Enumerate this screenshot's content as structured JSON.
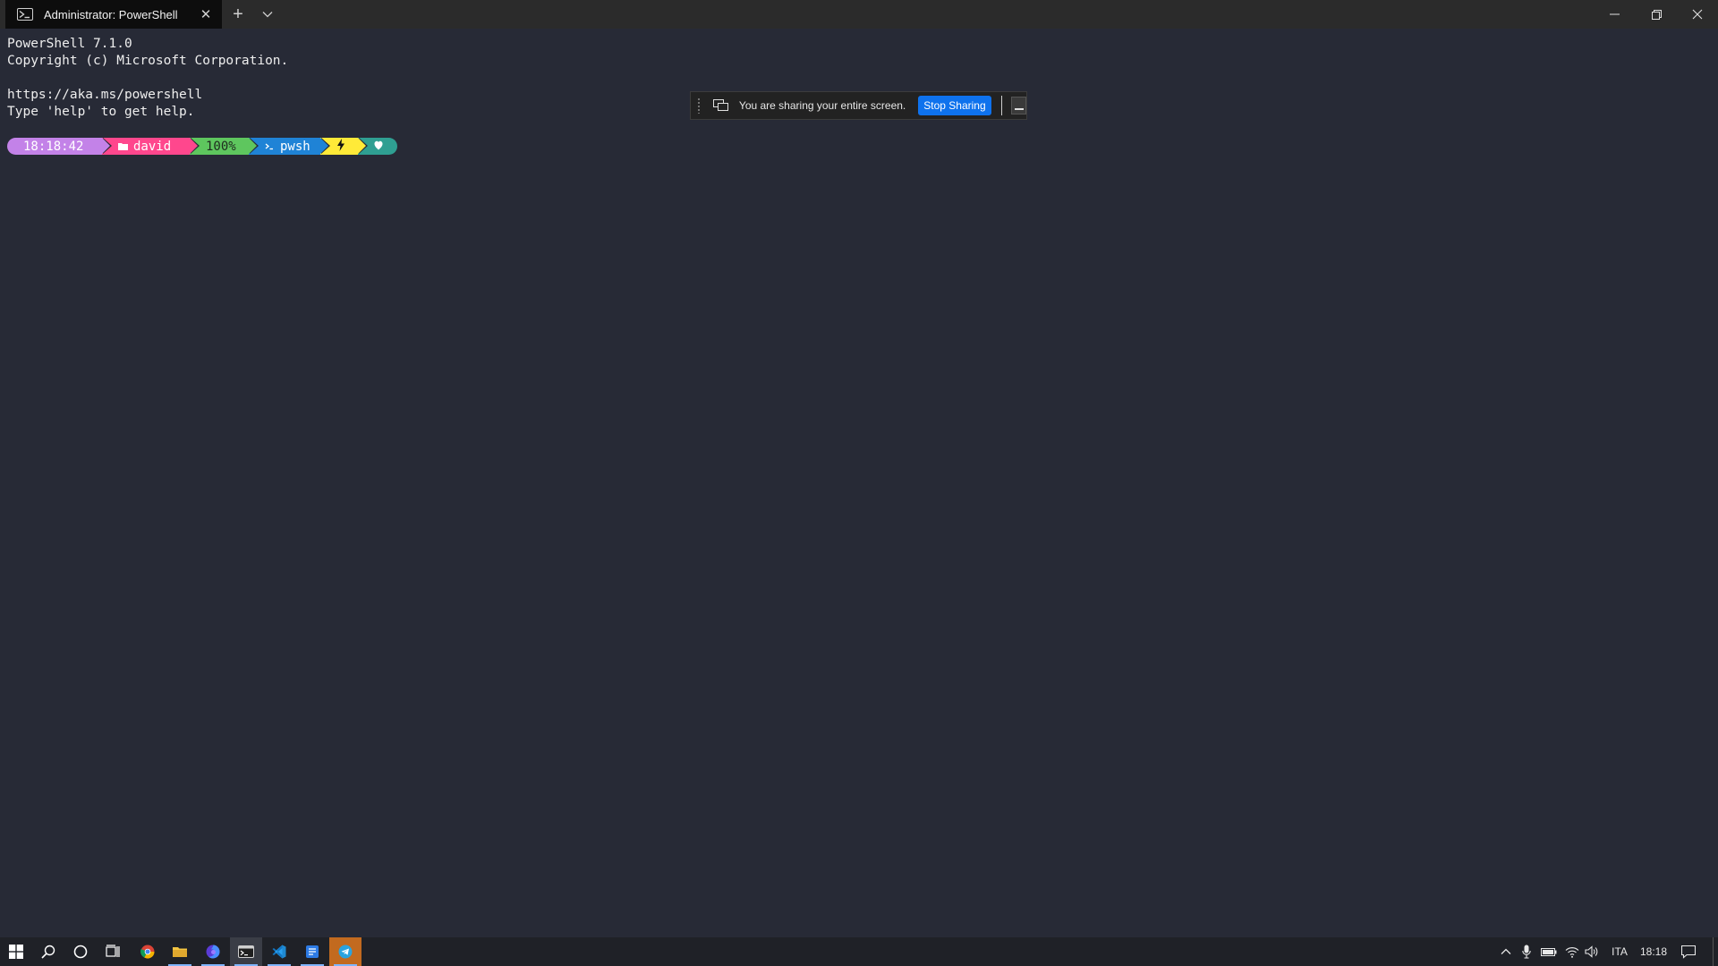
{
  "window": {
    "tab_title": "Administrator: PowerShell",
    "tab_icon": "powershell-icon",
    "new_tab_symbol": "+",
    "close_symbol": "✕"
  },
  "terminal": {
    "lines": [
      "PowerShell 7.1.0",
      "Copyright (c) Microsoft Corporation.",
      "",
      "https://aka.ms/powershell",
      "Type 'help' to get help."
    ]
  },
  "prompt": {
    "time": "18:18:42",
    "path": "david",
    "battery": "100%",
    "shell": "pwsh",
    "colors": {
      "time": "#c382e8",
      "path": "#ff478d",
      "battery": "#5ec65e",
      "shell": "#1f83d6",
      "root": "#ffea38",
      "exit": "#2f9f92"
    }
  },
  "sharing": {
    "message": "You are sharing your entire screen.",
    "stop_label": "Stop Sharing",
    "accent": "#0e72ed"
  },
  "taskbar": {
    "apps": [
      {
        "name": "chrome-icon"
      },
      {
        "name": "file-explorer-icon"
      },
      {
        "name": "firefox-icon"
      },
      {
        "name": "windows-terminal-icon"
      },
      {
        "name": "vscode-icon"
      },
      {
        "name": "notes-icon"
      },
      {
        "name": "telegram-icon"
      }
    ],
    "language": "ITA",
    "clock": "18:18"
  }
}
